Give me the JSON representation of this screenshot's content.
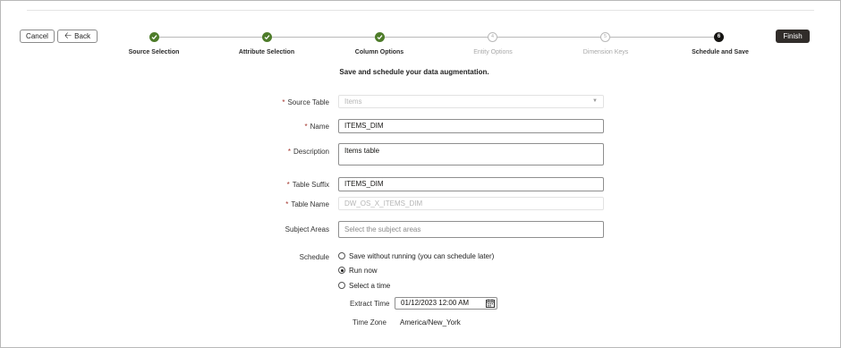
{
  "toolbar": {
    "cancel_label": "Cancel",
    "back_label": "Back",
    "finish_label": "Finish"
  },
  "steps": [
    {
      "label": "Source Selection",
      "state": "complete",
      "number": ""
    },
    {
      "label": "Attribute Selection",
      "state": "complete",
      "number": ""
    },
    {
      "label": "Column Options",
      "state": "complete",
      "number": ""
    },
    {
      "label": "Entity Options",
      "state": "disabled",
      "number": "4"
    },
    {
      "label": "Dimension Keys",
      "state": "disabled",
      "number": "5"
    },
    {
      "label": "Schedule and Save",
      "state": "current",
      "number": "6"
    }
  ],
  "page": {
    "subtitle": "Save and schedule your data augmentation."
  },
  "form": {
    "source_table": {
      "label": "Source Table",
      "value": "Items"
    },
    "name": {
      "label": "Name",
      "value": "ITEMS_DIM"
    },
    "description": {
      "label": "Description",
      "value": "Items table"
    },
    "table_suffix": {
      "label": "Table Suffix",
      "value": "ITEMS_DIM"
    },
    "table_name": {
      "label": "Table Name",
      "value": "DW_OS_X_ITEMS_DIM"
    },
    "subject_areas": {
      "label": "Subject Areas",
      "placeholder": "Select the subject areas"
    },
    "schedule": {
      "label": "Schedule",
      "options": [
        {
          "label": "Save without running (you can schedule later)",
          "checked": false
        },
        {
          "label": "Run now",
          "checked": true
        },
        {
          "label": "Select a time",
          "checked": false
        }
      ]
    },
    "extract_time": {
      "label": "Extract Time",
      "value": "01/12/2023 12:00 AM"
    },
    "time_zone": {
      "label": "Time Zone",
      "value": "America/New_York"
    }
  },
  "colors": {
    "complete": "#4e7c2a",
    "current": "#161513",
    "required": "#a3332a",
    "finish_bg": "#312d2a"
  }
}
